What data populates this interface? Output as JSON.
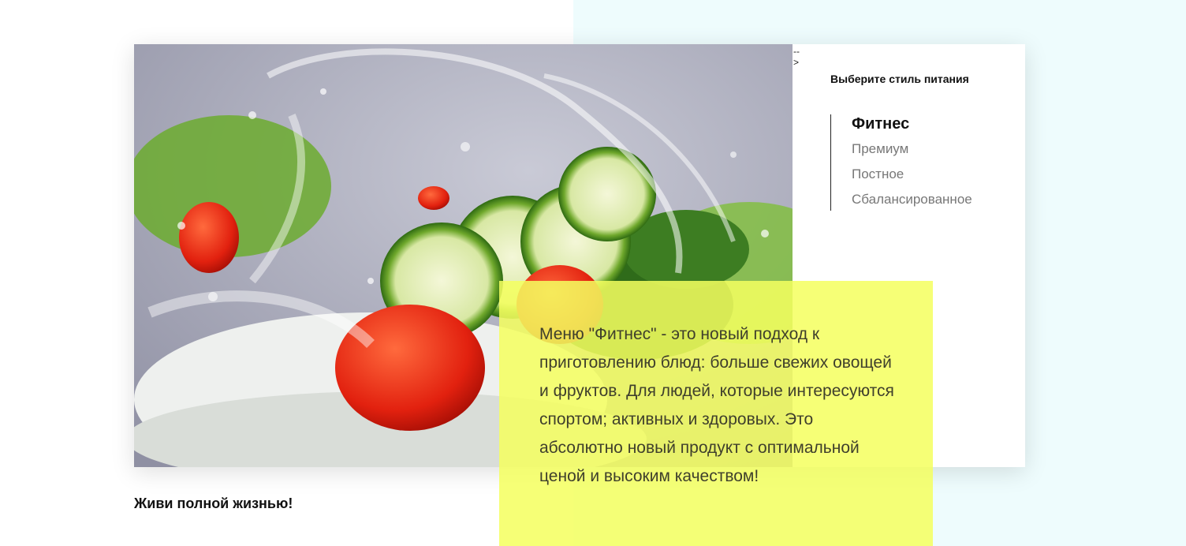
{
  "colors": {
    "right_background": "#eefcfd",
    "highlight_box": "#f5ff5f",
    "text_dark": "#111111",
    "text_muted": "#777777"
  },
  "stray_text": "-->",
  "menu": {
    "title": "Выберите стиль питания",
    "items": [
      {
        "label": "Фитнес",
        "active": true
      },
      {
        "label": "Премиум",
        "active": false
      },
      {
        "label": "Постное",
        "active": false
      },
      {
        "label": "Сбалансированное",
        "active": false
      }
    ]
  },
  "description": "Меню \"Фитнес\" - это новый подход к приготовлению блюд: больше свежих овощей и фруктов. Для людей, которые интересуются спортом; активных и здоровых. Это абсолютно новый продукт с оптимальной ценой и высоким качеством!",
  "tagline": "Живи полной жизнью!"
}
